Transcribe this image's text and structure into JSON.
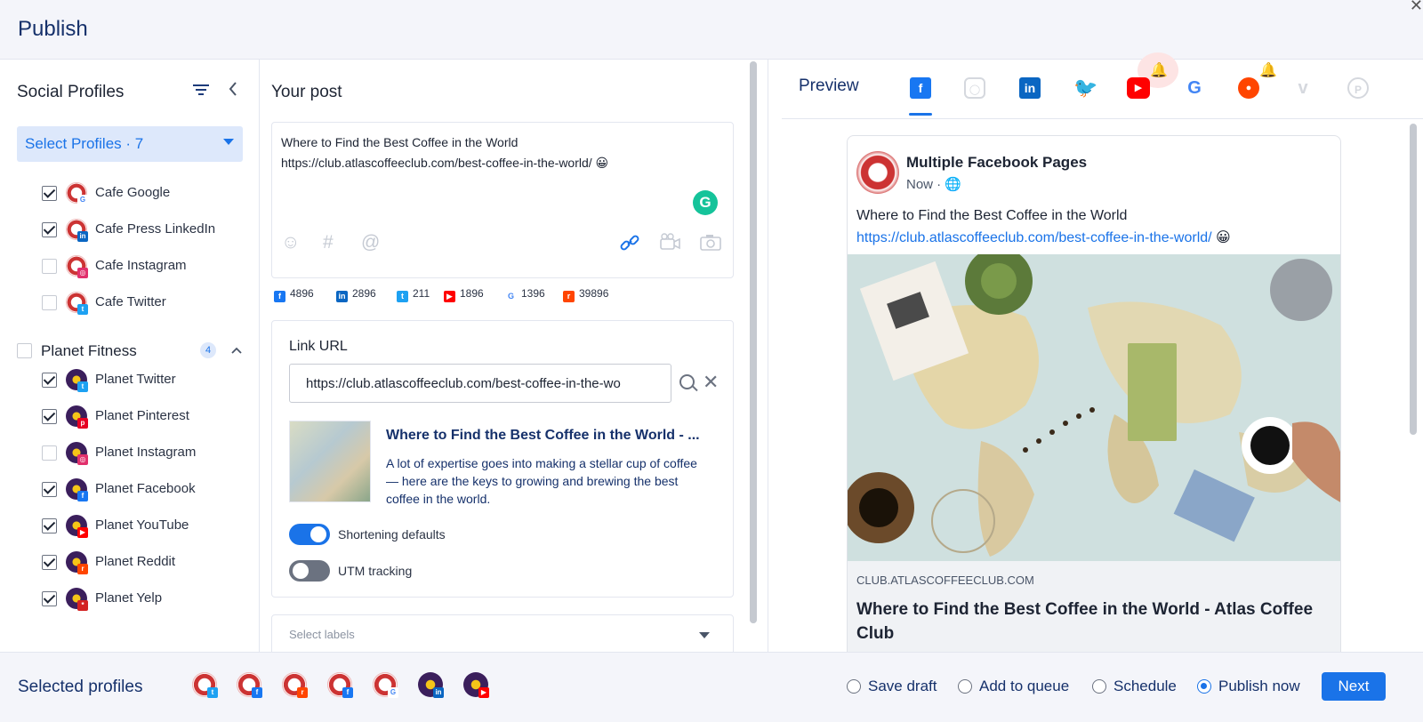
{
  "header": {
    "title": "Publish"
  },
  "left": {
    "title": "Social Profiles",
    "select_label": "Select Profiles · 7",
    "profiles_a": [
      {
        "label": "Cafe Google",
        "checked": true,
        "net": "google"
      },
      {
        "label": "Cafe Press LinkedIn",
        "checked": true,
        "net": "linkedin"
      },
      {
        "label": "Cafe Instagram",
        "checked": false,
        "net": "instagram"
      },
      {
        "label": "Cafe Twitter",
        "checked": false,
        "net": "twitter"
      }
    ],
    "group": {
      "label": "Planet Fitness",
      "count": "4"
    },
    "profiles_b": [
      {
        "label": "Planet Twitter",
        "checked": true,
        "net": "twitter"
      },
      {
        "label": "Planet Pinterest",
        "checked": true,
        "net": "pinterest"
      },
      {
        "label": "Planet Instagram",
        "checked": false,
        "net": "instagram"
      },
      {
        "label": "Planet Facebook",
        "checked": true,
        "net": "facebook"
      },
      {
        "label": "Planet YouTube",
        "checked": true,
        "net": "youtube"
      },
      {
        "label": "Planet Reddit",
        "checked": true,
        "net": "reddit"
      },
      {
        "label": "Planet Yelp",
        "checked": true,
        "net": "yelp"
      }
    ]
  },
  "post": {
    "title": "Your post",
    "line1": "Where to Find the Best Coffee in the World",
    "line2": "https://club.atlascoffeeclub.com/best-coffee-in-the-world/ 😀",
    "counts": [
      {
        "net": "facebook",
        "value": "4896"
      },
      {
        "net": "linkedin",
        "value": "2896"
      },
      {
        "net": "twitter",
        "value": "211"
      },
      {
        "net": "youtube",
        "value": "1896"
      },
      {
        "net": "google",
        "value": "1396"
      },
      {
        "net": "reddit",
        "value": "39896"
      }
    ]
  },
  "link": {
    "label": "Link URL",
    "url_value": "https://club.atlascoffeeclub.com/best-coffee-in-the-wo",
    "preview_title": "Where to Find the Best Coffee in the World - ...",
    "preview_desc": "A lot of expertise goes into making a stellar cup of coffee — here are the keys to growing and brewing the best coffee in the world.",
    "toggle1": {
      "label": "Shortening defaults",
      "on": true
    },
    "toggle2": {
      "label": "UTM tracking",
      "on": false
    },
    "labels_placeholder": "Select labels"
  },
  "preview": {
    "title": "Preview",
    "page_name": "Multiple Facebook Pages",
    "time": "Now · 🌐",
    "text1": "Where to Find the Best Coffee in the World",
    "text2": "https://club.atlascoffeeclub.com/best-coffee-in-the-world/",
    "text2_emoji": " 😀",
    "domain": "CLUB.ATLASCOFFEECLUB.COM",
    "link_title": "Where to Find the Best Coffee in the World - Atlas Coffee Club"
  },
  "footer": {
    "label": "Selected profiles",
    "options": [
      "Save draft",
      "Add to queue",
      "Schedule",
      "Publish now"
    ],
    "selected_option": "Publish now",
    "next_label": "Next"
  },
  "colors": {
    "accent": "#1a73e8",
    "facebook": "#1877f2",
    "linkedin": "#0a66c2",
    "twitter": "#1da1f2",
    "youtube": "#ff0000",
    "reddit": "#ff4500"
  }
}
